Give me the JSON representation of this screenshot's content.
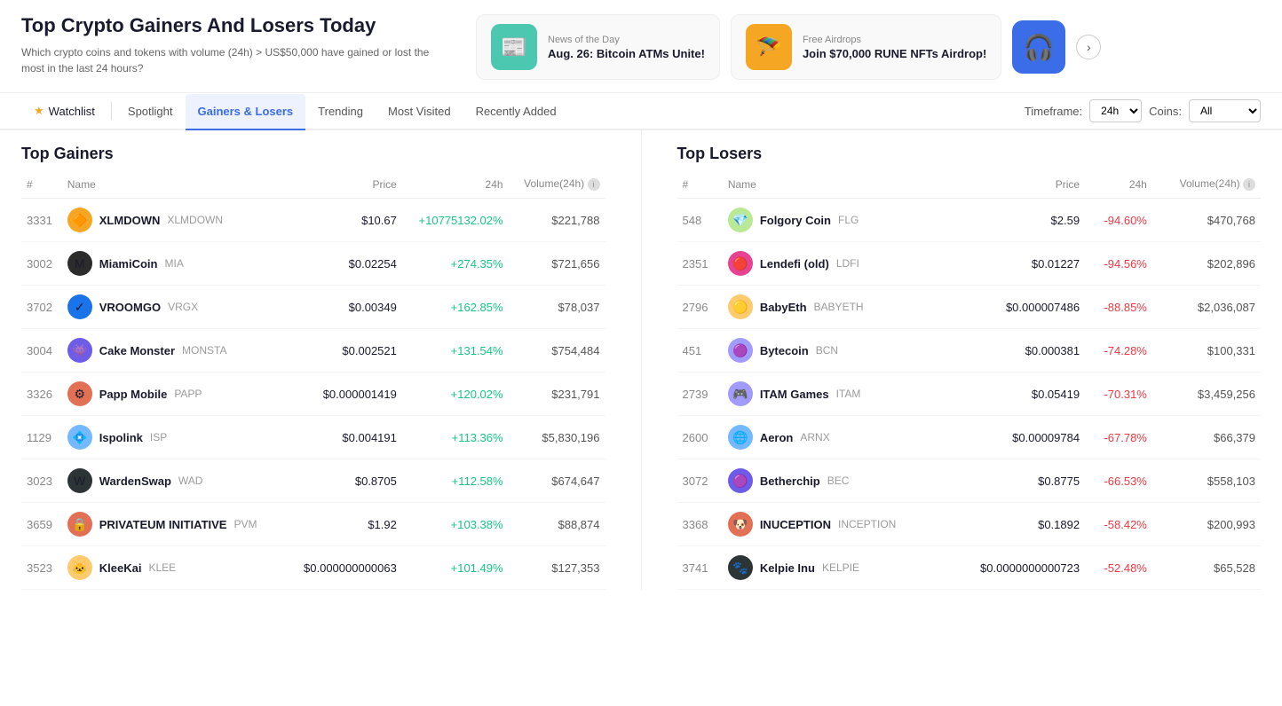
{
  "page": {
    "title": "Top Crypto Gainers And Losers Today",
    "subtitle": "Which crypto coins and tokens with volume (24h) > US$50,000 have gained or lost the most in the last 24 hours?"
  },
  "news_cards": [
    {
      "id": "news1",
      "tag": "News of the Day",
      "title": "Aug. 26: Bitcoin ATMs Unite!",
      "icon": "📰",
      "icon_bg": "green"
    },
    {
      "id": "news2",
      "tag": "Free Airdrops",
      "title": "Join $70,000 RUNE NFTs Airdrop!",
      "icon": "🪂",
      "icon_bg": "orange"
    }
  ],
  "nav": {
    "tabs": [
      {
        "id": "watchlist",
        "label": "Watchlist",
        "active": false,
        "watchlist": true
      },
      {
        "id": "spotlight",
        "label": "Spotlight",
        "active": false
      },
      {
        "id": "gainers-losers",
        "label": "Gainers & Losers",
        "active": true
      },
      {
        "id": "trending",
        "label": "Trending",
        "active": false
      },
      {
        "id": "most-visited",
        "label": "Most Visited",
        "active": false
      },
      {
        "id": "recently-added",
        "label": "Recently Added",
        "active": false
      }
    ],
    "timeframe_label": "Timeframe:",
    "timeframe_value": "24h",
    "coins_label": "Coins:",
    "coins_value": "All"
  },
  "gainers": {
    "title": "Top Gainers",
    "columns": [
      "#",
      "Name",
      "Price",
      "24h",
      "Volume(24h)"
    ],
    "rows": [
      {
        "rank": "3331",
        "name": "XLMDOWN",
        "symbol": "XLMDOWN",
        "price": "$10.67",
        "change": "+10775132.02%",
        "volume": "$221,788",
        "icon": "🔶",
        "icon_bg": "#f5a623"
      },
      {
        "rank": "3002",
        "name": "MiamiCoin",
        "symbol": "MIA",
        "price": "$0.02254",
        "change": "+274.35%",
        "volume": "$721,656",
        "icon": "M",
        "icon_bg": "#2c2c2c"
      },
      {
        "rank": "3702",
        "name": "VROOMGO",
        "symbol": "VRGX",
        "price": "$0.00349",
        "change": "+162.85%",
        "volume": "$78,037",
        "icon": "✓",
        "icon_bg": "#1a73e8"
      },
      {
        "rank": "3004",
        "name": "Cake Monster",
        "symbol": "MONSTA",
        "price": "$0.002521",
        "change": "+131.54%",
        "volume": "$754,484",
        "icon": "👾",
        "icon_bg": "#6c5ce7"
      },
      {
        "rank": "3326",
        "name": "Papp Mobile",
        "symbol": "PAPP",
        "price": "$0.000001419",
        "change": "+120.02%",
        "volume": "$231,791",
        "icon": "⚙",
        "icon_bg": "#e17055"
      },
      {
        "rank": "1129",
        "name": "Ispolink",
        "symbol": "ISP",
        "price": "$0.004191",
        "change": "+113.36%",
        "volume": "$5,830,196",
        "icon": "💠",
        "icon_bg": "#74b9ff"
      },
      {
        "rank": "3023",
        "name": "WardenSwap",
        "symbol": "WAD",
        "price": "$0.8705",
        "change": "+112.58%",
        "volume": "$674,647",
        "icon": "W",
        "icon_bg": "#2d3436"
      },
      {
        "rank": "3659",
        "name": "PRIVATEUM INITIATIVE",
        "symbol": "PVM",
        "price": "$1.92",
        "change": "+103.38%",
        "volume": "$88,874",
        "icon": "🔒",
        "icon_bg": "#e17055"
      },
      {
        "rank": "3523",
        "name": "KleeKai",
        "symbol": "KLEE",
        "price": "$0.000000000063",
        "change": "+101.49%",
        "volume": "$127,353",
        "icon": "🐱",
        "icon_bg": "#fdcb6e"
      }
    ]
  },
  "losers": {
    "title": "Top Losers",
    "columns": [
      "#",
      "Name",
      "Price",
      "24h",
      "Volume(24h)"
    ],
    "rows": [
      {
        "rank": "548",
        "name": "Folgory Coin",
        "symbol": "FLG",
        "price": "$2.59",
        "change": "-94.60%",
        "volume": "$470,768",
        "icon": "💎",
        "icon_bg": "#b8e994"
      },
      {
        "rank": "2351",
        "name": "Lendefi (old)",
        "symbol": "LDFI",
        "price": "$0.01227",
        "change": "-94.56%",
        "volume": "$202,896",
        "icon": "🔴",
        "icon_bg": "#e84393"
      },
      {
        "rank": "2796",
        "name": "BabyEth",
        "symbol": "BABYETH",
        "price": "$0.000007486",
        "change": "-88.85%",
        "volume": "$2,036,087",
        "icon": "🟡",
        "icon_bg": "#fdcb6e"
      },
      {
        "rank": "451",
        "name": "Bytecoin",
        "symbol": "BCN",
        "price": "$0.000381",
        "change": "-74.28%",
        "volume": "$100,331",
        "icon": "🟣",
        "icon_bg": "#a29bfe"
      },
      {
        "rank": "2739",
        "name": "ITAM Games",
        "symbol": "ITAM",
        "price": "$0.05419",
        "change": "-70.31%",
        "volume": "$3,459,256",
        "icon": "🎮",
        "icon_bg": "#a29bfe"
      },
      {
        "rank": "2600",
        "name": "Aeron",
        "symbol": "ARNX",
        "price": "$0.00009784",
        "change": "-67.78%",
        "volume": "$66,379",
        "icon": "🌐",
        "icon_bg": "#74b9ff"
      },
      {
        "rank": "3072",
        "name": "Betherchip",
        "symbol": "BEC",
        "price": "$0.8775",
        "change": "-66.53%",
        "volume": "$558,103",
        "icon": "🟣",
        "icon_bg": "#6c5ce7"
      },
      {
        "rank": "3368",
        "name": "INUCEPTION",
        "symbol": "INCEPTION",
        "price": "$0.1892",
        "change": "-58.42%",
        "volume": "$200,993",
        "icon": "🐶",
        "icon_bg": "#e17055"
      },
      {
        "rank": "3741",
        "name": "Kelpie Inu",
        "symbol": "KELPIE",
        "price": "$0.0000000000723",
        "change": "-52.48%",
        "volume": "$65,528",
        "icon": "🐾",
        "icon_bg": "#2d3436"
      }
    ]
  }
}
